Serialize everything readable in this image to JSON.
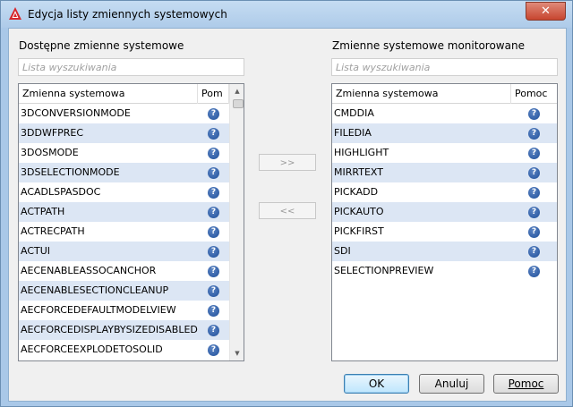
{
  "window": {
    "title": "Edycja listy zmiennych systemowych",
    "close_label": "✕"
  },
  "left": {
    "label": "Dostępne zmienne systemowe",
    "search_placeholder": "Lista wyszukiwania",
    "col_name": "Zmienna systemowa",
    "col_help": "Pom",
    "rows": [
      "3DCONVERSIONMODE",
      "3DDWFPREC",
      "3DOSMODE",
      "3DSELECTIONMODE",
      "ACADLSPASDOC",
      "ACTPATH",
      "ACTRECPATH",
      "ACTUI",
      "AECENABLEASSOCANCHOR",
      "AECENABLESECTIONCLEANUP",
      "AECFORCEDEFAULTMODELVIEW",
      "AECFORCEDISPLAYBYSIZEDISABLED",
      "AECFORCEEXPLODETOSOLID"
    ]
  },
  "right": {
    "label": "Zmienne systemowe monitorowane",
    "search_placeholder": "Lista wyszukiwania",
    "col_name": "Zmienna systemowa",
    "col_help": "Pomoc",
    "rows": [
      "CMDDIA",
      "FILEDIA",
      "HIGHLIGHT",
      "MIRRTEXT",
      "PICKADD",
      "PICKAUTO",
      "PICKFIRST",
      "SDI",
      "SELECTIONPREVIEW"
    ]
  },
  "middle": {
    "add_label": ">>",
    "remove_label": "<<"
  },
  "help_glyph": "?",
  "buttons": {
    "ok": "OK",
    "cancel": "Anuluj",
    "help": "Pomoc"
  },
  "colors": {
    "alt_row": "#dce6f4",
    "help_icon": "#1f4f9a",
    "default_button": "#3c7fb1"
  }
}
